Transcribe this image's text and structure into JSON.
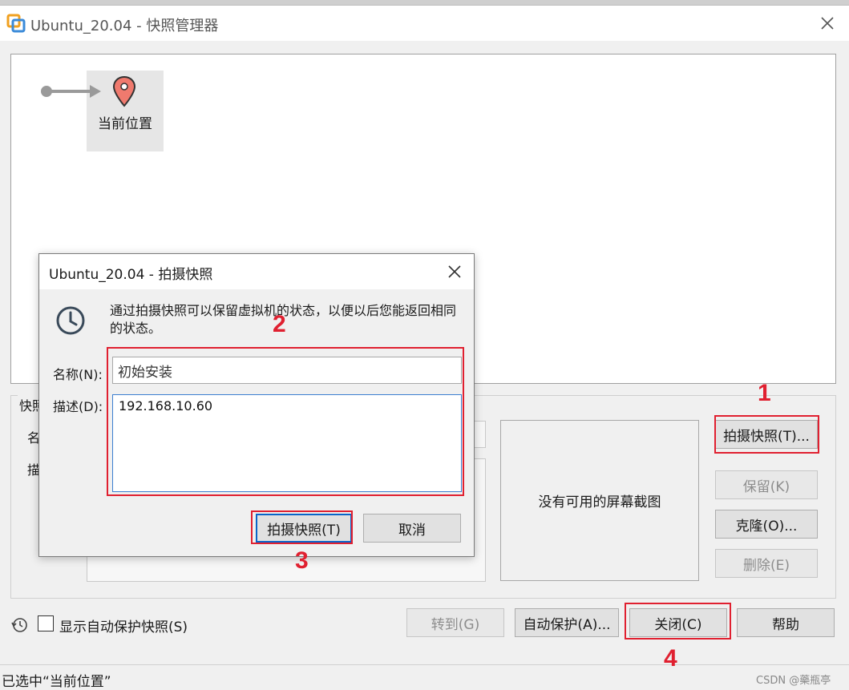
{
  "window": {
    "title": "Ubuntu_20.04 - 快照管理器"
  },
  "tree": {
    "current_node_label": "当前位置"
  },
  "details": {
    "group_label": "快照",
    "name_label_partial": "名",
    "desc_label_partial": "描",
    "no_screenshot_text": "没有可用的屏幕截图"
  },
  "side_buttons": {
    "take_snapshot": "拍摄快照(T)...",
    "keep": "保留(K)",
    "clone": "克隆(O)...",
    "delete": "删除(E)"
  },
  "bottom": {
    "show_autoprotect_label": "显示自动保护快照(S)",
    "goto": "转到(G)",
    "autoprotect": "自动保护(A)...",
    "close": "关闭(C)",
    "help": "帮助"
  },
  "status": {
    "text": "已选中“当前位置”"
  },
  "watermark": "CSDN @藥瓶亭",
  "dialog": {
    "title": "Ubuntu_20.04 - 拍摄快照",
    "info": "通过拍摄快照可以保留虚拟机的状态，以便以后您能返回相同的状态。",
    "name_label": "名称(N):",
    "name_value": "初始安装",
    "desc_label": "描述(D):",
    "desc_value": "192.168.10.60",
    "take_button": "拍摄快照(T)",
    "cancel_button": "取消"
  },
  "annotations": [
    "1",
    "2",
    "3",
    "4"
  ],
  "colors": {
    "annotation_red": "#e02030",
    "pin": "#f07a6e",
    "focus_blue": "#0a64c8"
  }
}
